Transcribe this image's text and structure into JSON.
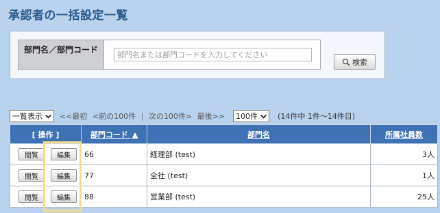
{
  "page": {
    "title": "承認者の一括設定一覧"
  },
  "search": {
    "label": "部門名／部門コード",
    "placeholder": "部門名または部門コードを入力してください",
    "button_label": "検索"
  },
  "toolbar": {
    "view_select": "一覧表示",
    "pager": {
      "first": "<<最初",
      "prev": "<前の100件",
      "sep": "|",
      "next": "次の100件>",
      "last": "最後>>"
    },
    "page_size": "100件",
    "count_text": "(14件中 1件～14件目)"
  },
  "table": {
    "headers": {
      "ops": "[ 操作 ]",
      "code": "部門コード",
      "sort_indicator": "▲",
      "name": "部門名",
      "count": "所属社員数"
    },
    "view_label": "閲覧",
    "edit_label": "編集",
    "rows": [
      {
        "code": "66",
        "name": "経理部 (test)",
        "count": "3人"
      },
      {
        "code": "77",
        "name": "全社 (test)",
        "count": "1人"
      },
      {
        "code": "88",
        "name": "営業部 (test)",
        "count": "25人"
      }
    ]
  },
  "colors": {
    "background": "#b9d3ee",
    "title": "#2b5a8c",
    "header": "#3f72b4",
    "highlight": "#f3dc8a"
  }
}
